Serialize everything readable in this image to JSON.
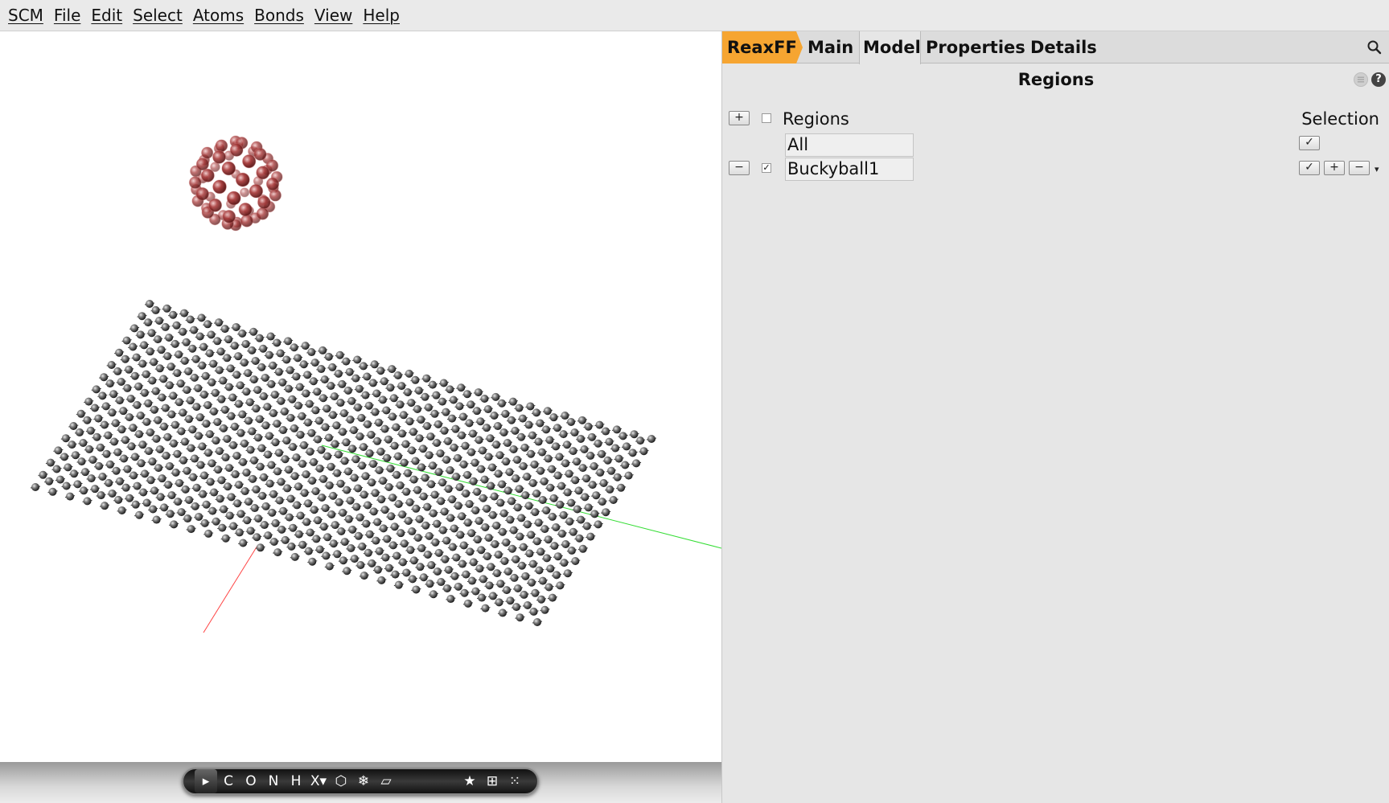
{
  "menubar": {
    "items": [
      "SCM",
      "File",
      "Edit",
      "Select",
      "Atoms",
      "Bonds",
      "View",
      "Help"
    ]
  },
  "toolbar": {
    "tools": {
      "pointer": "▸",
      "carbon": "C",
      "oxygen": "O",
      "nitrogen": "N",
      "hydrogen": "H",
      "other_element": "X▾",
      "ring": "⬡",
      "snowflake": "❄",
      "plane": "▱",
      "star": "★",
      "frame": "⊞",
      "dots": "⁙"
    }
  },
  "tabs": {
    "engine": "ReaxFF",
    "main": "Main",
    "model": "Model",
    "properties": "Properties",
    "details": "Details"
  },
  "panel": {
    "title": "Regions",
    "regions_header": "Regions",
    "selection_header": "Selection",
    "rows": [
      {
        "name": "All",
        "checked": false
      },
      {
        "name": "Buckyball1",
        "checked": true
      }
    ],
    "add_symbol": "+",
    "remove_symbol": "−",
    "check_symbol": "✓",
    "dropdown_symbol": "▾",
    "help_symbol": "?",
    "menu_symbol": "≡"
  },
  "colors": {
    "engine_tab": "#f6a531",
    "graphene_atom": "#5a5a5a",
    "buckyball_atom": "#a83b3b",
    "axis_x": "#ff4444",
    "axis_y": "#33dd33",
    "toolbar_bg": "#1a1a1a"
  }
}
